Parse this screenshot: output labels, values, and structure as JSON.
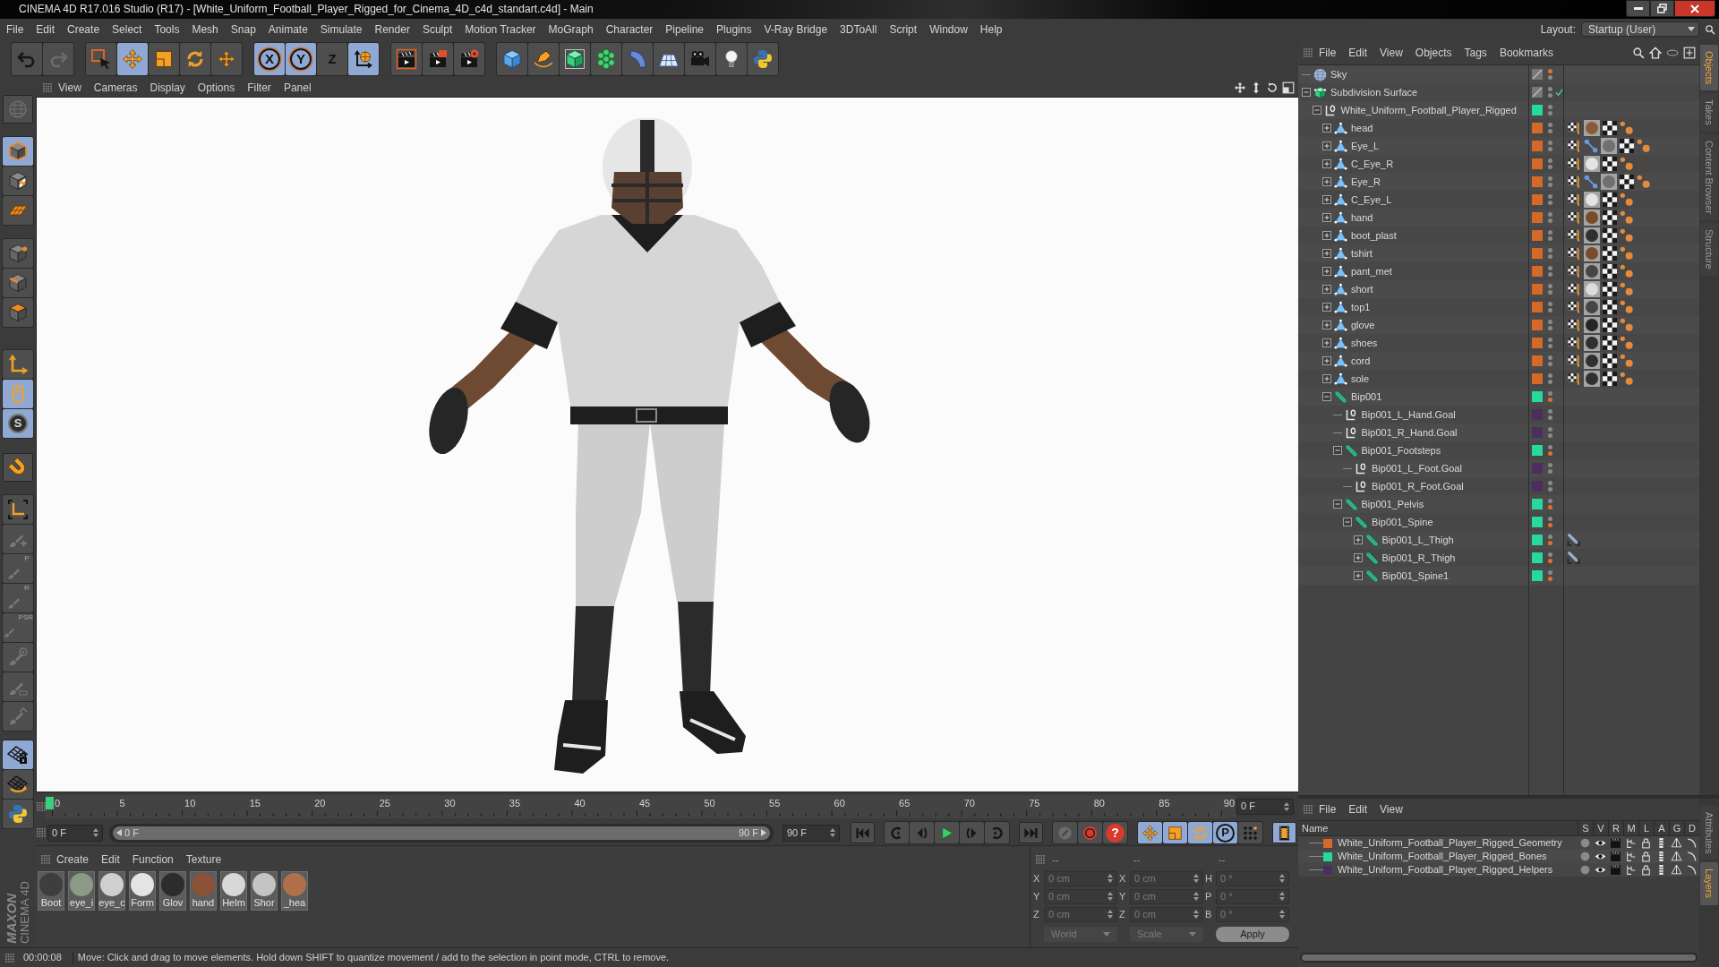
{
  "title_bar": {
    "title": "CINEMA 4D R17.016 Studio (R17) - [White_Uniform_Football_Player_Rigged_for_Cinema_4D_c4d_standart.c4d] - Main"
  },
  "menu_bar": {
    "items": [
      "File",
      "Edit",
      "Create",
      "Select",
      "Tools",
      "Mesh",
      "Snap",
      "Animate",
      "Simulate",
      "Render",
      "Sculpt",
      "Motion Tracker",
      "MoGraph",
      "Character",
      "Pipeline",
      "Plugins",
      "V-Ray Bridge",
      "3DToAll",
      "Script",
      "Window",
      "Help"
    ],
    "layout_label": "Layout:",
    "layout_value": "Startup (User)"
  },
  "toolbar": {
    "groups": [
      {
        "items": [
          {
            "kind": "undo",
            "selected": false,
            "disabled": false
          },
          {
            "kind": "redo",
            "selected": false,
            "disabled": true
          }
        ]
      },
      {
        "items": [
          {
            "kind": "select",
            "selected": false,
            "disabled": false
          },
          {
            "kind": "move",
            "selected": true,
            "disabled": false
          },
          {
            "kind": "scale",
            "selected": false,
            "disabled": false
          },
          {
            "kind": "rotate",
            "selected": false,
            "disabled": false
          },
          {
            "kind": "transform",
            "selected": false,
            "disabled": false
          }
        ]
      },
      {
        "items": [
          {
            "kind": "axis",
            "label": "X",
            "selected": true,
            "disabled": false
          },
          {
            "kind": "axis",
            "label": "Y",
            "selected": true,
            "disabled": false
          },
          {
            "kind": "axis",
            "label": "Z",
            "selected": false,
            "disabled": false
          },
          {
            "kind": "coords",
            "selected": true,
            "disabled": false
          }
        ]
      },
      {
        "items": [
          {
            "kind": "render_view",
            "selected": false,
            "disabled": false
          },
          {
            "kind": "render_picture",
            "selected": false,
            "disabled": false
          },
          {
            "kind": "render_settings",
            "selected": false,
            "disabled": false
          }
        ]
      },
      {
        "items": [
          {
            "kind": "cube",
            "selected": false,
            "disabled": false
          },
          {
            "kind": "pen",
            "selected": false,
            "disabled": false
          },
          {
            "kind": "subdivision",
            "selected": false,
            "disabled": false
          },
          {
            "kind": "cloner",
            "selected": false,
            "disabled": false
          },
          {
            "kind": "deformer",
            "selected": false,
            "disabled": false
          },
          {
            "kind": "floor",
            "selected": false,
            "disabled": false
          },
          {
            "kind": "camera",
            "selected": false,
            "disabled": false
          },
          {
            "kind": "light",
            "selected": false,
            "disabled": false
          },
          {
            "kind": "python",
            "selected": false,
            "disabled": false
          }
        ]
      }
    ]
  },
  "left_toolbar": {
    "groups": [
      {
        "items": [
          {
            "kind": "globe_grid",
            "selected": false,
            "disabled": true
          }
        ]
      },
      {
        "items": [
          {
            "kind": "model",
            "selected": true,
            "disabled": false
          },
          {
            "kind": "texture_cube",
            "selected": false,
            "disabled": false
          },
          {
            "kind": "workplane",
            "selected": false,
            "disabled": false
          }
        ]
      },
      {
        "items": [
          {
            "kind": "points",
            "selected": false,
            "disabled": false
          },
          {
            "kind": "edges",
            "selected": false,
            "disabled": false
          },
          {
            "kind": "polygons",
            "selected": false,
            "disabled": false
          }
        ]
      },
      {
        "items": [
          {
            "kind": "axis_mode",
            "selected": false,
            "disabled": false
          },
          {
            "kind": "tweak",
            "selected": true,
            "disabled": false
          },
          {
            "kind": "snap",
            "label": "S",
            "selected": true,
            "disabled": false
          }
        ]
      },
      {
        "items": [
          {
            "kind": "magnet",
            "selected": false,
            "disabled": false
          }
        ]
      },
      {
        "items": [
          {
            "kind": "axis_corners",
            "selected": false,
            "disabled": false
          },
          {
            "kind": "brush_plus",
            "selected": false,
            "disabled": true
          },
          {
            "kind": "brush",
            "label": "P",
            "selected": false,
            "disabled": true
          },
          {
            "kind": "brush",
            "label": "R",
            "selected": false,
            "disabled": true
          },
          {
            "kind": "brush",
            "label": "PSR",
            "selected": false,
            "disabled": true
          },
          {
            "kind": "brush_target",
            "selected": false,
            "disabled": true
          },
          {
            "kind": "brush_bar",
            "selected": false,
            "disabled": true
          },
          {
            "kind": "brush_arrow",
            "selected": false,
            "disabled": true
          }
        ]
      },
      {
        "items": [
          {
            "kind": "grid_lock",
            "selected": true,
            "disabled": false
          },
          {
            "kind": "grid_rotate",
            "selected": false,
            "disabled": false
          },
          {
            "kind": "python",
            "selected": false,
            "disabled": false
          }
        ]
      }
    ]
  },
  "logo": {
    "brand": "MAXON",
    "product": "CINEMA 4D"
  },
  "viewport": {
    "menu": [
      "View",
      "Cameras",
      "Display",
      "Options",
      "Filter",
      "Panel"
    ]
  },
  "timeline": {
    "frames": [
      "0",
      "5",
      "10",
      "15",
      "20",
      "25",
      "30",
      "35",
      "40",
      "45",
      "50",
      "55",
      "60",
      "65",
      "70",
      "75",
      "80",
      "85",
      "90"
    ],
    "level": 0,
    "current_frame": "0 F"
  },
  "range": {
    "start_field": "0 F",
    "start": "0 F",
    "end": "90 F",
    "end_field": "90 F",
    "level": 1
  },
  "transport": {
    "groups": [
      {
        "items": [
          {
            "kind": "go_start",
            "selected": false,
            "disabled": false
          }
        ]
      },
      {
        "items": [
          {
            "kind": "prev_key",
            "selected": false,
            "disabled": false
          },
          {
            "kind": "prev_frame",
            "selected": false,
            "disabled": false
          },
          {
            "kind": "play",
            "selected": false,
            "disabled": false
          },
          {
            "kind": "next_frame",
            "selected": false,
            "disabled": false
          },
          {
            "kind": "next_key",
            "selected": false,
            "disabled": false
          }
        ]
      },
      {
        "items": [
          {
            "kind": "go_end",
            "selected": false,
            "disabled": false
          }
        ]
      },
      {
        "items": [
          {
            "kind": "key_link",
            "selected": false,
            "disabled": true
          },
          {
            "kind": "record",
            "selected": false,
            "disabled": false
          },
          {
            "kind": "autokey",
            "label": "?",
            "selected": false,
            "disabled": false
          }
        ]
      },
      {
        "items": [
          {
            "kind": "key_move",
            "selected": true,
            "disabled": false
          },
          {
            "kind": "key_scale",
            "selected": true,
            "disabled": false
          },
          {
            "kind": "key_rotate",
            "selected": true,
            "disabled": false
          },
          {
            "kind": "key_param",
            "label": "P",
            "selected": true,
            "disabled": false
          },
          {
            "kind": "key_points",
            "selected": false,
            "disabled": false
          }
        ]
      },
      {
        "items": [
          {
            "kind": "timeline",
            "selected": true,
            "disabled": false
          }
        ]
      }
    ]
  },
  "material_manager": {
    "menu": [
      "Create",
      "Edit",
      "Function",
      "Texture"
    ],
    "materials": [
      {
        "label": "Boot",
        "color": "#3e3e3e"
      },
      {
        "label": "eye_i",
        "color": "#8c9a88"
      },
      {
        "label": "eye_c",
        "color": "#cfcfcf"
      },
      {
        "label": "Form",
        "color": "#e4e4e4"
      },
      {
        "label": "Glov",
        "color": "#2c2c2c"
      },
      {
        "label": "hand",
        "color": "#8a5236"
      },
      {
        "label": "Helm",
        "color": "#d8d8d8"
      },
      {
        "label": "Shor",
        "color": "#c4c4c4"
      },
      {
        "label": "_hea",
        "color": "#b0704a"
      }
    ]
  },
  "coordinates": {
    "disabled": true,
    "headers": [
      "--",
      "--",
      "--"
    ],
    "rows": [
      {
        "fields": [
          {
            "axis": "X",
            "value": "0 cm"
          },
          {
            "axis": "X",
            "value": "0 cm"
          },
          {
            "axis": "H",
            "value": "0 °"
          }
        ]
      },
      {
        "fields": [
          {
            "axis": "Y",
            "value": "0 cm"
          },
          {
            "axis": "Y",
            "value": "0 cm"
          },
          {
            "axis": "P",
            "value": "0 °"
          }
        ]
      },
      {
        "fields": [
          {
            "axis": "Z",
            "value": "0 cm"
          },
          {
            "axis": "Z",
            "value": "0 cm"
          },
          {
            "axis": "B",
            "value": "0 °"
          }
        ]
      }
    ],
    "dropdowns": [
      "World",
      "Scale"
    ],
    "apply": "Apply"
  },
  "status_bar": {
    "time": "00:00:08",
    "message": "Move: Click and drag to move elements. Hold down SHIFT to quantize movement / add to the selection in point mode, CTRL to remove."
  },
  "object_manager": {
    "menu": [
      "File",
      "Edit",
      "View",
      "Objects",
      "Tags",
      "Bookmarks"
    ],
    "objects": [
      {
        "name": "Sky",
        "kind": "sky",
        "editor_hidden": true,
        "render_hidden": false
      },
      {
        "name": "Subdivision Surface",
        "kind": "subdivision",
        "editor_hidden": false,
        "render_hidden": false,
        "checked": true,
        "expanded": true,
        "children": [
          {
            "name": "White_Uniform_Football_Player_Rigged",
            "kind": "null",
            "color": "#26d99c",
            "editor_hidden": false,
            "render_hidden": false,
            "expanded": true,
            "children": [
              {
                "name": "head",
                "kind": "polygon",
                "color": "#d4692a",
                "editor_hidden": false,
                "render_hidden": false,
                "expanded": false,
                "tags": [
                  {
                    "kind": "uvw"
                  },
                  {
                    "kind": "material",
                    "color": "#8a5a3a"
                  },
                  {
                    "kind": "selection"
                  },
                  {
                    "kind": "weight"
                  }
                ]
              },
              {
                "name": "Eye_L",
                "kind": "polygon",
                "color": "#d4692a",
                "editor_hidden": false,
                "render_hidden": false,
                "expanded": false,
                "tags": [
                  {
                    "kind": "uvw"
                  },
                  {
                    "kind": "constraint"
                  },
                  {
                    "kind": "material",
                    "color": "#707070"
                  },
                  {
                    "kind": "selection"
                  },
                  {
                    "kind": "weight"
                  }
                ]
              },
              {
                "name": "C_Eye_R",
                "kind": "polygon",
                "color": "#d4692a",
                "editor_hidden": false,
                "render_hidden": false,
                "expanded": false,
                "tags": [
                  {
                    "kind": "uvw"
                  },
                  {
                    "kind": "material",
                    "color": "#e4e4e4"
                  },
                  {
                    "kind": "selection"
                  },
                  {
                    "kind": "weight"
                  }
                ]
              },
              {
                "name": "Eye_R",
                "kind": "polygon",
                "color": "#d4692a",
                "editor_hidden": false,
                "render_hidden": false,
                "expanded": false,
                "tags": [
                  {
                    "kind": "uvw"
                  },
                  {
                    "kind": "constraint"
                  },
                  {
                    "kind": "material",
                    "color": "#707070"
                  },
                  {
                    "kind": "selection"
                  },
                  {
                    "kind": "weight"
                  }
                ]
              },
              {
                "name": "C_Eye_L",
                "kind": "polygon",
                "color": "#d4692a",
                "editor_hidden": false,
                "render_hidden": false,
                "expanded": false,
                "tags": [
                  {
                    "kind": "uvw"
                  },
                  {
                    "kind": "material",
                    "color": "#e4e4e4"
                  },
                  {
                    "kind": "selection"
                  },
                  {
                    "kind": "weight"
                  }
                ]
              },
              {
                "name": "hand",
                "kind": "polygon",
                "color": "#d4692a",
                "editor_hidden": false,
                "render_hidden": false,
                "expanded": false,
                "tags": [
                  {
                    "kind": "uvw"
                  },
                  {
                    "kind": "material",
                    "color": "#7a4a2a"
                  },
                  {
                    "kind": "selection"
                  },
                  {
                    "kind": "weight"
                  }
                ]
              },
              {
                "name": "boot_plast",
                "kind": "polygon",
                "color": "#d4692a",
                "editor_hidden": false,
                "render_hidden": false,
                "expanded": false,
                "tags": [
                  {
                    "kind": "uvw"
                  },
                  {
                    "kind": "material",
                    "color": "#303030"
                  },
                  {
                    "kind": "selection"
                  },
                  {
                    "kind": "weight"
                  }
                ]
              },
              {
                "name": "tshirt",
                "kind": "polygon",
                "color": "#d4692a",
                "editor_hidden": false,
                "render_hidden": false,
                "expanded": false,
                "tags": [
                  {
                    "kind": "uvw"
                  },
                  {
                    "kind": "material",
                    "color": "#7a4a2a"
                  },
                  {
                    "kind": "selection"
                  },
                  {
                    "kind": "weight"
                  }
                ]
              },
              {
                "name": "pant_met",
                "kind": "polygon",
                "color": "#d4692a",
                "editor_hidden": false,
                "render_hidden": false,
                "expanded": false,
                "tags": [
                  {
                    "kind": "uvw"
                  },
                  {
                    "kind": "material",
                    "color": "#454545"
                  },
                  {
                    "kind": "selection"
                  },
                  {
                    "kind": "weight"
                  }
                ]
              },
              {
                "name": "short",
                "kind": "polygon",
                "color": "#d4692a",
                "editor_hidden": false,
                "render_hidden": false,
                "expanded": false,
                "tags": [
                  {
                    "kind": "uvw"
                  },
                  {
                    "kind": "material",
                    "color": "#dcdcdc"
                  },
                  {
                    "kind": "selection"
                  },
                  {
                    "kind": "weight"
                  }
                ]
              },
              {
                "name": "top1",
                "kind": "polygon",
                "color": "#d4692a",
                "editor_hidden": false,
                "render_hidden": false,
                "expanded": false,
                "tags": [
                  {
                    "kind": "uvw"
                  },
                  {
                    "kind": "material",
                    "color": "#454545"
                  },
                  {
                    "kind": "selection"
                  },
                  {
                    "kind": "weight"
                  }
                ]
              },
              {
                "name": "glove",
                "kind": "polygon",
                "color": "#d4692a",
                "editor_hidden": false,
                "render_hidden": false,
                "expanded": false,
                "tags": [
                  {
                    "kind": "uvw"
                  },
                  {
                    "kind": "material",
                    "color": "#252525"
                  },
                  {
                    "kind": "selection"
                  },
                  {
                    "kind": "weight"
                  }
                ]
              },
              {
                "name": "shoes",
                "kind": "polygon",
                "color": "#d4692a",
                "editor_hidden": false,
                "render_hidden": false,
                "expanded": false,
                "tags": [
                  {
                    "kind": "uvw"
                  },
                  {
                    "kind": "material",
                    "color": "#303030"
                  },
                  {
                    "kind": "selection"
                  },
                  {
                    "kind": "weight"
                  }
                ]
              },
              {
                "name": "cord",
                "kind": "polygon",
                "color": "#d4692a",
                "editor_hidden": false,
                "render_hidden": false,
                "expanded": false,
                "tags": [
                  {
                    "kind": "uvw"
                  },
                  {
                    "kind": "material",
                    "color": "#303030"
                  },
                  {
                    "kind": "selection"
                  },
                  {
                    "kind": "weight"
                  }
                ]
              },
              {
                "name": "sole",
                "kind": "polygon",
                "color": "#d4692a",
                "editor_hidden": false,
                "render_hidden": false,
                "expanded": false,
                "tags": [
                  {
                    "kind": "uvw"
                  },
                  {
                    "kind": "material",
                    "color": "#303030"
                  },
                  {
                    "kind": "selection"
                  },
                  {
                    "kind": "weight"
                  }
                ]
              },
              {
                "name": "Bip001",
                "kind": "bone",
                "color": "#26d99c",
                "editor_hidden": false,
                "render_hidden": true,
                "expanded": true,
                "children": [
                  {
                    "name": "Bip001_L_Hand.Goal",
                    "kind": "null",
                    "color": "#4b2e5c",
                    "editor_hidden": false,
                    "render_hidden": false
                  },
                  {
                    "name": "Bip001_R_Hand.Goal",
                    "kind": "null",
                    "color": "#4b2e5c",
                    "editor_hidden": false,
                    "render_hidden": false
                  },
                  {
                    "name": "Bip001_Footsteps",
                    "kind": "bone",
                    "color": "#26d99c",
                    "editor_hidden": false,
                    "render_hidden": true,
                    "expanded": true,
                    "children": [
                      {
                        "name": "Bip001_L_Foot.Goal",
                        "kind": "null",
                        "color": "#4b2e5c",
                        "editor_hidden": false,
                        "render_hidden": false
                      },
                      {
                        "name": "Bip001_R_Foot.Goal",
                        "kind": "null",
                        "color": "#4b2e5c",
                        "editor_hidden": false,
                        "render_hidden": false
                      }
                    ]
                  },
                  {
                    "name": "Bip001_Pelvis",
                    "kind": "bone",
                    "color": "#26d99c",
                    "editor_hidden": false,
                    "render_hidden": true,
                    "expanded": true,
                    "children": [
                      {
                        "name": "Bip001_Spine",
                        "kind": "bone",
                        "color": "#26d99c",
                        "editor_hidden": false,
                        "render_hidden": true,
                        "expanded": true,
                        "children": [
                          {
                            "name": "Bip001_L_Thigh",
                            "kind": "bone",
                            "color": "#26d99c",
                            "editor_hidden": false,
                            "render_hidden": true,
                            "expanded": false,
                            "tags": [
                              {
                                "kind": "ik"
                              }
                            ]
                          },
                          {
                            "name": "Bip001_R_Thigh",
                            "kind": "bone",
                            "color": "#26d99c",
                            "editor_hidden": false,
                            "render_hidden": true,
                            "expanded": false,
                            "tags": [
                              {
                                "kind": "ik"
                              }
                            ]
                          },
                          {
                            "name": "Bip001_Spine1",
                            "kind": "bone",
                            "color": "#26d99c",
                            "editor_hidden": false,
                            "render_hidden": true,
                            "expanded": false
                          }
                        ]
                      }
                    ]
                  }
                ]
              }
            ]
          }
        ]
      }
    ]
  },
  "layers_manager": {
    "menu": [
      "File",
      "Edit",
      "View"
    ],
    "columns": [
      "Name",
      "S",
      "V",
      "R",
      "M",
      "L",
      "A",
      "G",
      "D"
    ],
    "layers": [
      {
        "name": "White_Uniform_Football_Player_Rigged_Geometry",
        "color": "#d4692a"
      },
      {
        "name": "White_Uniform_Football_Player_Rigged_Bones",
        "color": "#26d99c"
      },
      {
        "name": "White_Uniform_Football_Player_Rigged_Helpers",
        "color": "#4b2e5c"
      }
    ]
  },
  "side_tabs": {
    "top": [
      {
        "label": "Objects",
        "selected": true
      },
      {
        "label": "Takes",
        "selected": false
      },
      {
        "label": "Content Browser",
        "selected": false
      },
      {
        "label": "Structure",
        "selected": false
      }
    ],
    "bottom": [
      {
        "label": "Attributes",
        "selected": false
      },
      {
        "label": "Layers",
        "selected": true
      }
    ]
  }
}
